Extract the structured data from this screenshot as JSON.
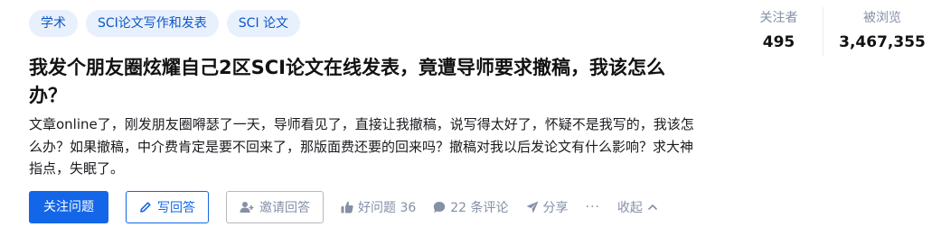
{
  "topics": [
    "学术",
    "SCI论文写作和发表",
    "SCI 论文"
  ],
  "stats": {
    "followers_label": "关注者",
    "followers_value": "495",
    "views_label": "被浏览",
    "views_value": "3,467,355"
  },
  "question": {
    "title": "我发个朋友圈炫耀自己2区SCI论文在线发表，竟遭导师要求撤稿，我该怎么办？",
    "excerpt": "文章online了，刚发朋友圈嘚瑟了一天，导师看见了，直接让我撤稿，说写得太好了，怀疑不是我写的，我该怎么办？如果撤稿，中介费肯定是要不回来了，那版面费还要的回来吗？撤稿对我以后发论文有什么影响？求大神指点，失眠了。"
  },
  "actions": {
    "follow_label": "关注问题",
    "answer_label": "写回答",
    "invite_label": "邀请回答",
    "good_question_label": "好问题 36",
    "comments_label": "22 条评论",
    "share_label": "分享",
    "more_label": "···",
    "collapse_label": "收起"
  },
  "colors": {
    "accent": "#1366e8",
    "topic_bg": "#e8f0fc",
    "muted": "#8590a6"
  },
  "icons": [
    "pencil-icon",
    "add-user-icon",
    "like-icon",
    "comment-icon",
    "share-icon",
    "chevron-up-icon"
  ]
}
